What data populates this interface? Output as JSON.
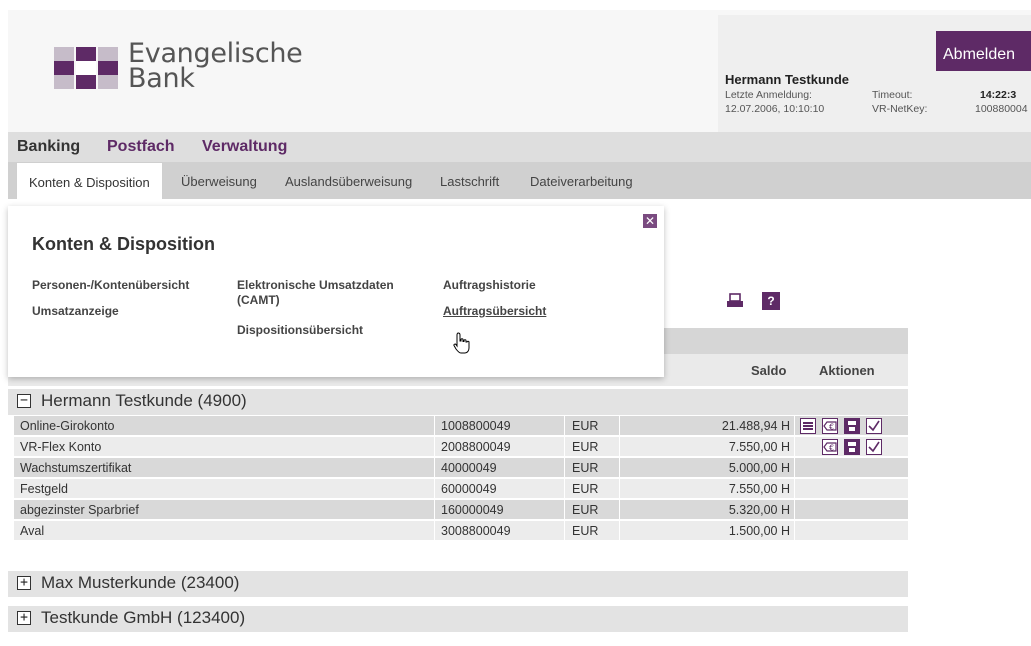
{
  "brand": {
    "name_line1": "Evangelische",
    "name_line2": "Bank",
    "accent": "#5e2a66"
  },
  "header": {
    "logout_label": "Abmelden",
    "user_name": "Hermann Testkunde",
    "last_login_label": "Letzte Anmeldung:",
    "last_login_value": "12.07.2006, 10:10:10",
    "timeout_label": "Timeout:",
    "timeout_value": "14:22:3",
    "netkey_label": "VR-NetKey:",
    "netkey_value": "100880004"
  },
  "main_nav": [
    {
      "label": "Banking",
      "active": true
    },
    {
      "label": "Postfach",
      "active": false
    },
    {
      "label": "Verwaltung",
      "active": false
    }
  ],
  "sub_nav": [
    {
      "label": "Konten & Disposition",
      "active": true
    },
    {
      "label": "Überweisung"
    },
    {
      "label": "Auslandsüberweisung"
    },
    {
      "label": "Lastschrift"
    },
    {
      "label": "Dateiverarbeitung"
    }
  ],
  "popup": {
    "title": "Konten & Disposition",
    "close_icon": "close-icon",
    "links": {
      "personen": "Personen-/Kontenübersicht",
      "umsatz": "Umsatzanzeige",
      "camt_line1": "Elektronische Umsatzdaten",
      "camt_line2": "(CAMT)",
      "dispo": "Dispositionsübersicht",
      "historie": "Auftragshistorie",
      "uebersicht": "Auftragsübersicht"
    }
  },
  "toolbar": {
    "print_icon": "printer-icon",
    "help_label": "?"
  },
  "table": {
    "columns": {
      "saldo": "Saldo",
      "aktionen": "Aktionen"
    },
    "groups": [
      {
        "title": "Hermann Testkunde (4900)",
        "expanded": true,
        "toggle": "−",
        "rows": [
          {
            "name": "Online-Girokonto",
            "number": "1008800049",
            "currency": "EUR",
            "saldo": "21.488,94 H",
            "actions": [
              "list-icon",
              "euro-icon",
              "save-icon",
              "check-icon"
            ]
          },
          {
            "name": "VR-Flex Konto",
            "number": "2008800049",
            "currency": "EUR",
            "saldo": "7.550,00 H",
            "actions": [
              "euro-icon",
              "save-icon",
              "check-icon"
            ]
          },
          {
            "name": "Wachstumszertifikat",
            "number": "40000049",
            "currency": "EUR",
            "saldo": "5.000,00 H",
            "actions": []
          },
          {
            "name": "Festgeld",
            "number": "60000049",
            "currency": "EUR",
            "saldo": "7.550,00 H",
            "actions": []
          },
          {
            "name": "abgezinster Sparbrief",
            "number": "160000049",
            "currency": "EUR",
            "saldo": "5.320,00 H",
            "actions": []
          },
          {
            "name": "Aval",
            "number": "3008800049",
            "currency": "EUR",
            "saldo": "1.500,00 H",
            "actions": []
          }
        ]
      },
      {
        "title": "Max Musterkunde (23400)",
        "expanded": false,
        "toggle": "+"
      },
      {
        "title": "Testkunde GmbH (123400)",
        "expanded": false,
        "toggle": "+"
      }
    ]
  }
}
